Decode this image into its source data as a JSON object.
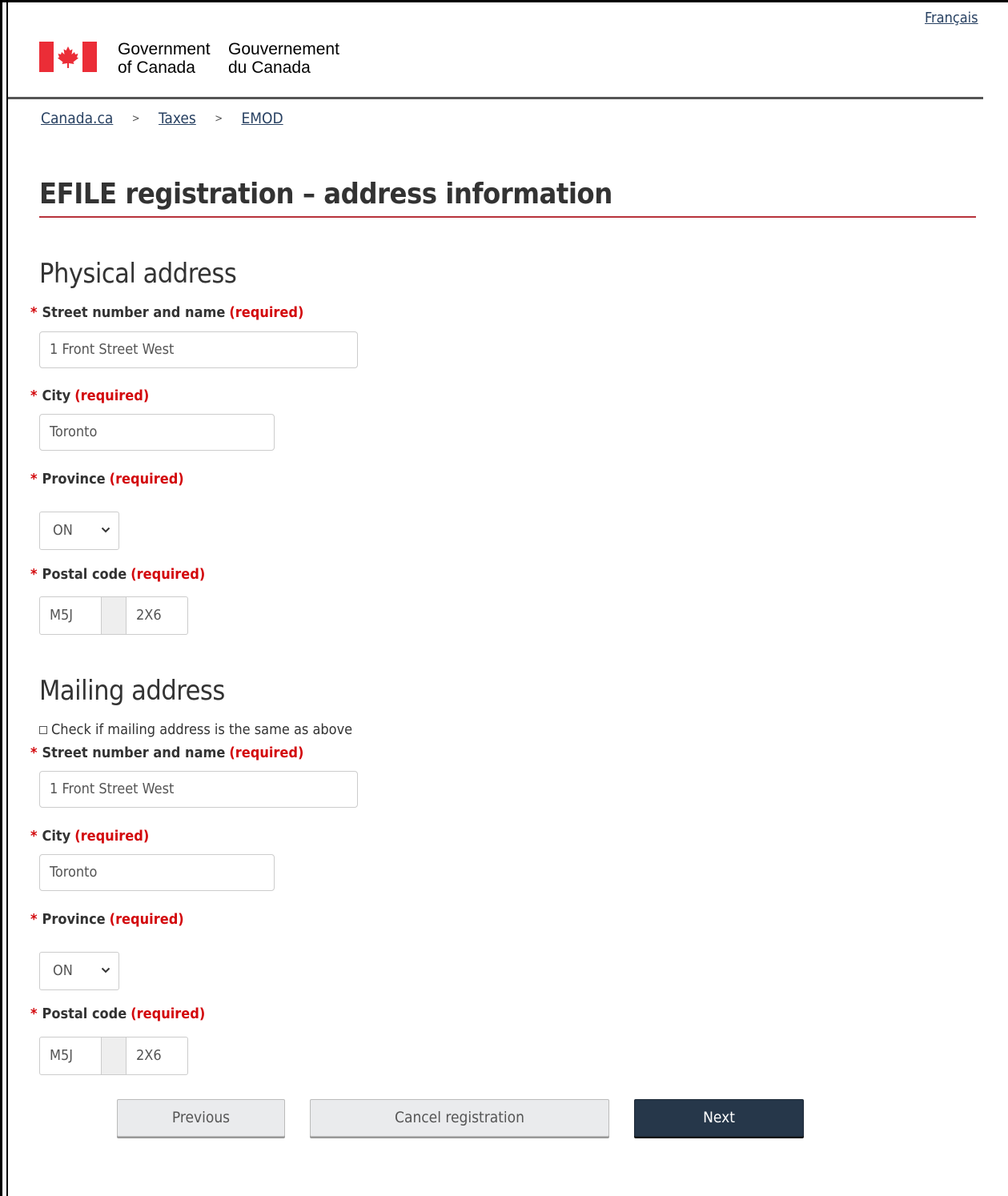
{
  "header": {
    "language_link": "Français",
    "brand_en_line1": "Government",
    "brand_en_line2": "of Canada",
    "brand_fr_line1": "Gouvernement",
    "brand_fr_line2": "du Canada",
    "flag_colors": {
      "red": "#eb2d37",
      "white": "#ffffff"
    }
  },
  "breadcrumb": {
    "items": [
      "Canada.ca",
      "Taxes",
      "EMOD"
    ],
    "separator": ">"
  },
  "page_title": "EFILE registration – address information",
  "labels": {
    "required_star": "*",
    "required_text": "(required)",
    "street": "Street number and name",
    "city": "City",
    "province": "Province",
    "postal": "Postal code"
  },
  "physical": {
    "heading": "Physical address",
    "street": "1 Front Street West",
    "city": "Toronto",
    "province": "ON",
    "postal_first": "M5J",
    "postal_second": "2X6"
  },
  "mailing": {
    "heading": "Mailing address",
    "same_as_above_label": "Check if mailing address is the same as above",
    "same_as_above_checked": false,
    "street": "1 Front Street West",
    "city": "Toronto",
    "province": "ON",
    "postal_first": "M5J",
    "postal_second": "2X6"
  },
  "buttons": {
    "previous": "Previous",
    "cancel": "Cancel registration",
    "next": "Next"
  },
  "colors": {
    "accent_red": "#d3080c",
    "title_rule": "#b7323a",
    "link": "#284162",
    "primary_button": "#26374a"
  }
}
